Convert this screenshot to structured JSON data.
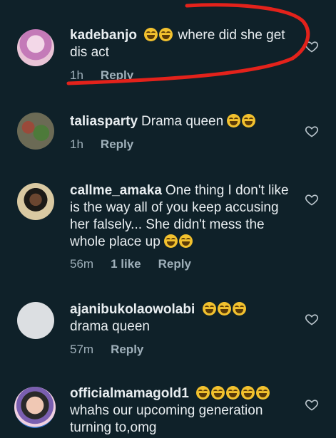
{
  "comments": [
    {
      "username": "kadebanjo",
      "emoji_count": 2,
      "text": "where did she get dis act",
      "time": "1h",
      "likes": "",
      "reply": "Reply",
      "avatar_color": "#c8a8d0"
    },
    {
      "username": "taliasparty",
      "emoji_count": 2,
      "text": "Drama queen",
      "text_before_emoji": true,
      "time": "1h",
      "likes": "",
      "reply": "Reply",
      "avatar_color": "#5b6b4a"
    },
    {
      "username": "callme_amaka",
      "emoji_count": 2,
      "text": "One thing I don't like is the way all of you keep accusing her falsely... She didn't mess the whole place up",
      "text_before_emoji": true,
      "time": "56m",
      "likes": "1 like",
      "reply": "Reply",
      "avatar_color": "#c9b48a"
    },
    {
      "username": "ajanibukolaowolabi",
      "emoji_count": 3,
      "text": "drama queen",
      "time": "57m",
      "likes": "",
      "reply": "Reply",
      "avatar_color": "#dcdfe2"
    },
    {
      "username": "officialmamagold1",
      "emoji_count": 5,
      "text": "whahs our upcoming generation turning to,omg",
      "time": "",
      "likes": "",
      "reply": "",
      "avatar_color": "#b07a8a"
    }
  ],
  "colors": {
    "background": "#0f2129",
    "annotation": "#e3221b"
  }
}
